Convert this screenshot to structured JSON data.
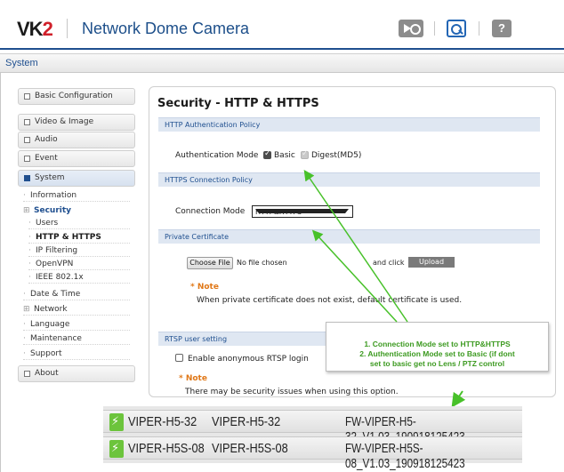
{
  "header": {
    "logo_main": "VK",
    "logo_accent": "2",
    "product_name": "Network Dome Camera",
    "help_glyph": "?"
  },
  "page": {
    "section_title": "System",
    "title": "Security - HTTP & HTTPS"
  },
  "sidebar": {
    "top_items": [
      {
        "label": "Basic Configuration"
      },
      {
        "label": "Video & Image"
      },
      {
        "label": "Audio"
      },
      {
        "label": "Event"
      },
      {
        "label": "System"
      }
    ],
    "system_sub": [
      {
        "label": "Information"
      },
      {
        "label": "Security"
      },
      {
        "label": "Users"
      },
      {
        "label": "HTTP & HTTPS"
      },
      {
        "label": "IP Filtering"
      },
      {
        "label": "OpenVPN"
      },
      {
        "label": "IEEE 802.1x"
      },
      {
        "label": "Date & Time"
      },
      {
        "label": "Network"
      },
      {
        "label": "Language"
      },
      {
        "label": "Maintenance"
      },
      {
        "label": "Support"
      }
    ],
    "about": {
      "label": "About"
    }
  },
  "content": {
    "http_auth": {
      "header": "HTTP Authentication Policy",
      "label": "Authentication Mode",
      "basic_label": "Basic",
      "basic_checked": true,
      "digest_label": "Digest(MD5)",
      "digest_checked": true
    },
    "https": {
      "header": "HTTPS Connection Policy",
      "label": "Connection Mode",
      "selected": "HTTP&HTTPS"
    },
    "private_cert": {
      "header": "Private Certificate",
      "choose_file": "Choose File",
      "no_file": "No file chosen",
      "and_click": "and click",
      "upload": "Upload",
      "note_label": "* Note",
      "note_text": "When private certificate does not exist, default certificate is used."
    },
    "rtsp": {
      "header": "RTSP user setting",
      "anon_label": "Enable anonymous RTSP login",
      "note_label": "* Note",
      "note_text": "There may be security issues when using this option."
    }
  },
  "callout": {
    "line1": "1. Connection Mode set to HTTP&HTTPS",
    "line2": "2. Authentication Mode set to Basic (if dont",
    "line3": "set to basic get no Lens / PTZ control"
  },
  "firmware_rows": [
    {
      "model": "VIPER-H5-32",
      "name": "VIPER-H5-32",
      "fw": "FW-VIPER-H5-32_V1.03_190918125423"
    },
    {
      "model": "VIPER-H5S-08",
      "name": "VIPER-H5S-08",
      "fw": "FW-VIPER-H5S-08_V1.03_190918125423"
    }
  ],
  "colors": {
    "brand_blue": "#1f4f8f",
    "brand_red": "#d0202a",
    "note_orange": "#e07818",
    "annotation_green": "#3c9a20"
  }
}
